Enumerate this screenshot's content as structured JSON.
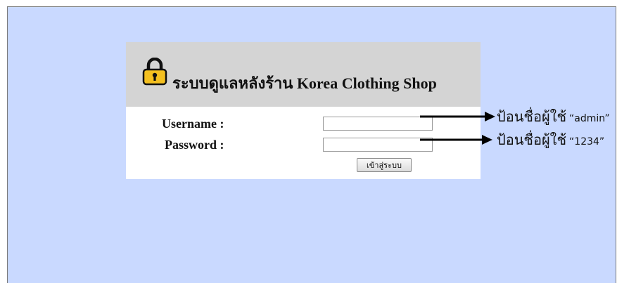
{
  "header": {
    "title": "ระบบดูแลหลังร้าน Korea Clothing Shop",
    "icon": "lock-icon",
    "icon_color": "#f4c020",
    "background_color": "#d4d4d4"
  },
  "page": {
    "background_color": "#c9d9ff"
  },
  "form": {
    "username_label": "Username :",
    "password_label": "Password :",
    "username_value": "",
    "password_value": "",
    "submit_label": "เข้าสู่ระบบ"
  },
  "annotations": {
    "username_text": "ป้อนชื่อผู้ใช้",
    "username_hint": "“admin”",
    "password_text": "ป้อนชื่อผู้ใช้",
    "password_hint": "“1234”"
  }
}
